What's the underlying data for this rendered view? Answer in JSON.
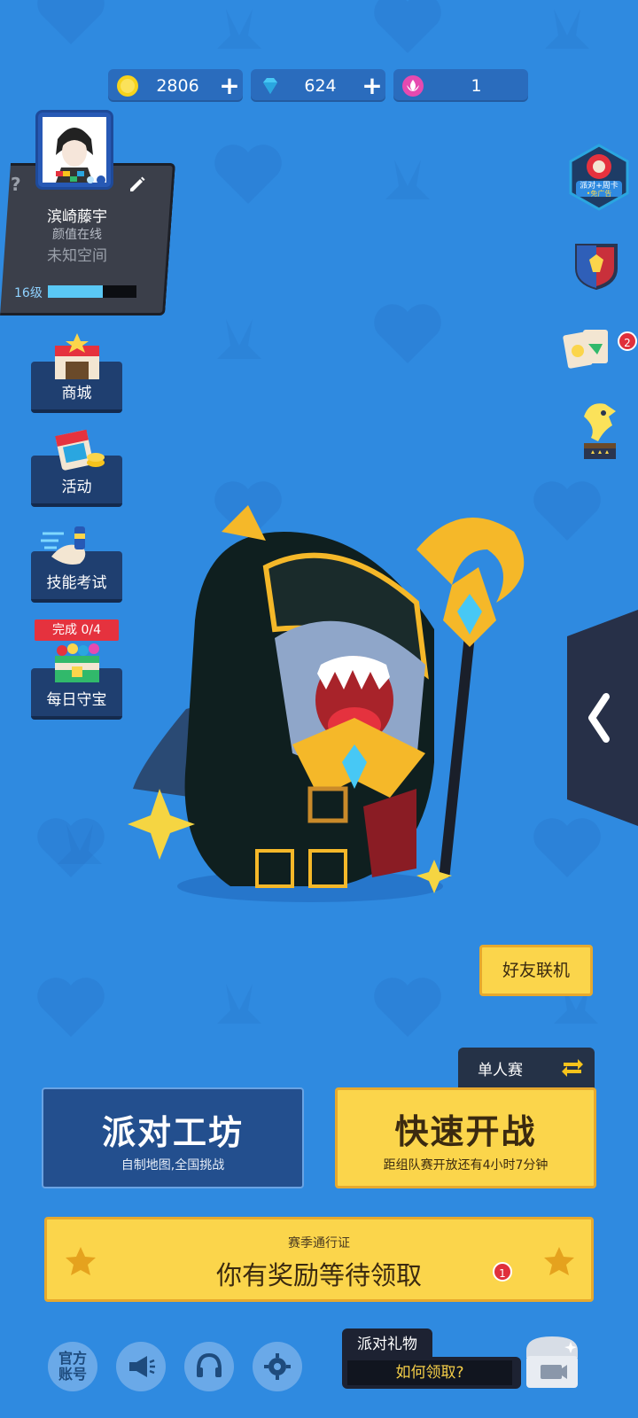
{
  "currency": {
    "coins": "2806",
    "gems": "624",
    "lotus": "1"
  },
  "profile": {
    "name": "滨崎藤宇",
    "subtitle": "颜值在线",
    "space": "未知空间",
    "level_text": "16级",
    "xp_progress": 0.62,
    "help_symbol": "?"
  },
  "side_menu": [
    {
      "label": "商城",
      "icon": "shop-icon"
    },
    {
      "label": "活动",
      "icon": "calendar-icon"
    },
    {
      "label": "技能考试",
      "icon": "exam-icon"
    },
    {
      "label": "每日守宝",
      "icon": "treasure-icon"
    }
  ],
  "daily_progress": "完成 0/4",
  "right_icons": {
    "party_card_badge": "派对+周卡\n免广告",
    "cards_badge": "2"
  },
  "friend_button": "好友联机",
  "mode_tab": "单人赛",
  "workshop": {
    "title": "派对工坊",
    "subtitle": "自制地图,全国挑战"
  },
  "quick_battle": {
    "title": "快速开战",
    "subtitle": "距组队赛开放还有4小时7分钟"
  },
  "season_pass": {
    "title": "赛季通行证",
    "message": "你有奖励等待领取",
    "badge": "1"
  },
  "bottom": {
    "official_line1": "官方",
    "official_line2": "账号",
    "gift_title": "派对礼物",
    "gift_how": "如何领取?"
  },
  "colors": {
    "background": "#2f8ae0",
    "yellow": "#fbd54b",
    "dark_blue_button": "#234f8e"
  }
}
